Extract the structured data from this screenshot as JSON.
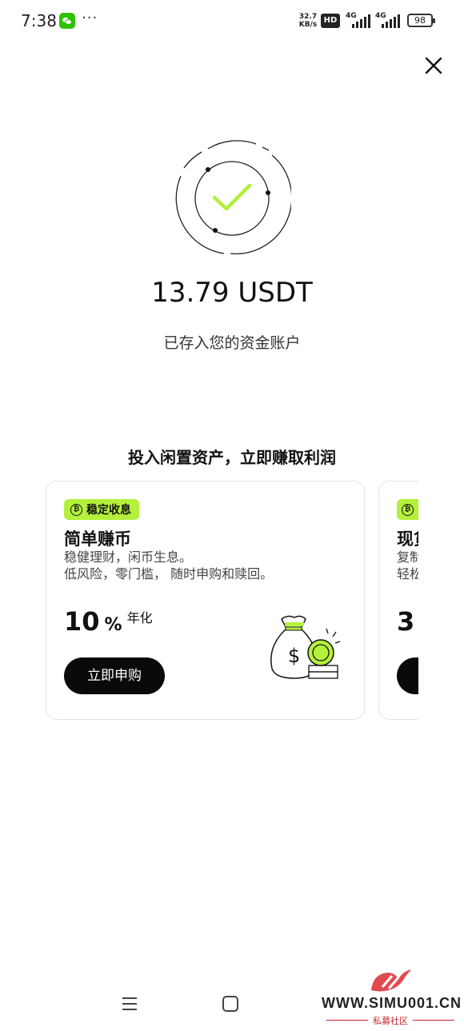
{
  "status_bar": {
    "time": "7:38",
    "more": "···",
    "net_speed_value": "32.7",
    "net_speed_unit": "KB/s",
    "hd": "HD",
    "signal_1_tag": "4G",
    "signal_2_tag": "4G",
    "battery": "98",
    "icons": [
      "wechat-icon",
      "signal-icon",
      "battery-icon"
    ]
  },
  "close_icon": "close-icon",
  "success": {
    "icon": "check-icon",
    "amount": "13.79 USDT",
    "subtitle": "已存入您的资金账户",
    "accent_color": "#b4f03c"
  },
  "promo": {
    "title": "投入闲置资产，立即赚取利润",
    "cards": [
      {
        "badge": "稳定收息",
        "heading": "简单赚币",
        "desc_line1": "稳健理财，闲币生息。",
        "desc_line2": "低风险，零门槛， 随时申购和赎回。",
        "rate_value": "10",
        "rate_unit": "%",
        "rate_label": "年化",
        "button": "立即申购",
        "illustration": "money-bag-coin-icon"
      },
      {
        "heading": "现货",
        "desc_line1": "复制",
        "desc_line2": "轻松",
        "rate_value": "3"
      }
    ]
  },
  "nav": {
    "icons": [
      "menu-icon",
      "home-icon"
    ]
  },
  "watermark": {
    "text": "WWW.SIMU001.CN",
    "sub": "私募社区"
  }
}
